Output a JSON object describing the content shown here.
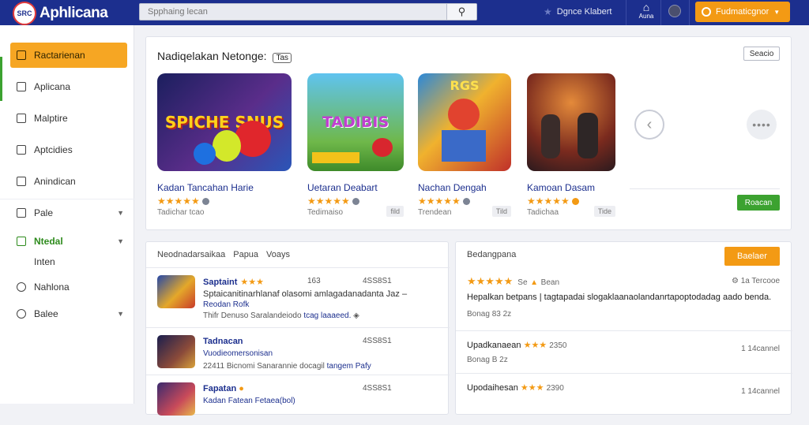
{
  "header": {
    "logo_badge": "SRC",
    "logo_text": "Aphlicana",
    "search_placeholder": "Spphaing lecan",
    "search_icon": "search-icon",
    "top_link": "Dgnce Klabert",
    "apps_label": "Auna",
    "cta_label": "Fudmaticgnor"
  },
  "sidebar": {
    "items": [
      {
        "label": "Ractarienan",
        "active": true
      },
      {
        "label": "Aplicana"
      },
      {
        "label": "Malptire"
      },
      {
        "label": "Aptcidies"
      },
      {
        "label": "Anindican"
      },
      {
        "label": "Pale"
      },
      {
        "label": "Ntedal"
      },
      {
        "label": "Inten"
      },
      {
        "label": "Nahlona"
      },
      {
        "label": "Balee"
      }
    ]
  },
  "recommended": {
    "title": "Nadiqelakan Netonge:",
    "title_tag": "Tas",
    "see_label": "Seacio",
    "green_button": "Roacan",
    "cards": [
      {
        "title": "Kadan Tancahan Harie",
        "art": "SPICHE SNUS",
        "meta": "Tadichar tcao",
        "pill": ""
      },
      {
        "title": "Uetaran Deabart",
        "art": "TADIBIS",
        "meta": "Tedimaiso",
        "pill": "fild"
      },
      {
        "title": "Nachan Dengah",
        "art": "RGS",
        "meta": "Trendean",
        "pill": "Tild"
      },
      {
        "title": "Kamoan Dasam",
        "art": "",
        "meta": "Tadichaa",
        "pill": "Tide"
      }
    ]
  },
  "list": {
    "tabs": [
      "Neodnadarsaikaa",
      "Papua",
      "Voays"
    ],
    "rows": [
      {
        "name": "Saptaint",
        "stars": "★★★",
        "num": "163",
        "id": "4SS8S1",
        "desc": "Sptaicanitinarhlanaf olasomi amlagadanadanta Jaz –",
        "sub": "Reodan Rofk",
        "meta": "Thifr",
        "meta_tail": "Denuso Saralandeiodo",
        "meta_link": "tcag laaaeed."
      },
      {
        "name": "Tadnacan",
        "stars": "",
        "num": "",
        "id": "4SS8S1",
        "desc": "",
        "sub": "Vuodieomersonisan",
        "meta": "22411",
        "meta_tail": "Bicnomi Sanarannie docagil",
        "meta_link": "tangem Pafy"
      },
      {
        "name": "Fapatan",
        "stars": "",
        "num": "",
        "id": "4SS8S1",
        "desc": "",
        "sub": "Kadan Fatean Fetaea(bol)",
        "meta": "",
        "meta_tail": "",
        "meta_link": ""
      }
    ]
  },
  "reviews": {
    "heading": "Bedangpana",
    "button": "Baelaer",
    "top_stars": "★★★★★",
    "top_meta": "Se",
    "top_meta2": "Bean",
    "top_stat": "1a Tercooe",
    "text": "Hepalkan betpans | tagtapadai slogaklaanaolandanrtapoptodadag aado benda.",
    "date1": "Bonag 83 2z",
    "items": [
      {
        "name": "Upadkanaean",
        "stars": "★★★",
        "num": "2350",
        "count": "1 14cannel",
        "date": "Bonag B 2z"
      },
      {
        "name": "Upodaihesan",
        "stars": "★★★",
        "num": "2390",
        "count": "1 14cannel",
        "date": ""
      }
    ]
  }
}
